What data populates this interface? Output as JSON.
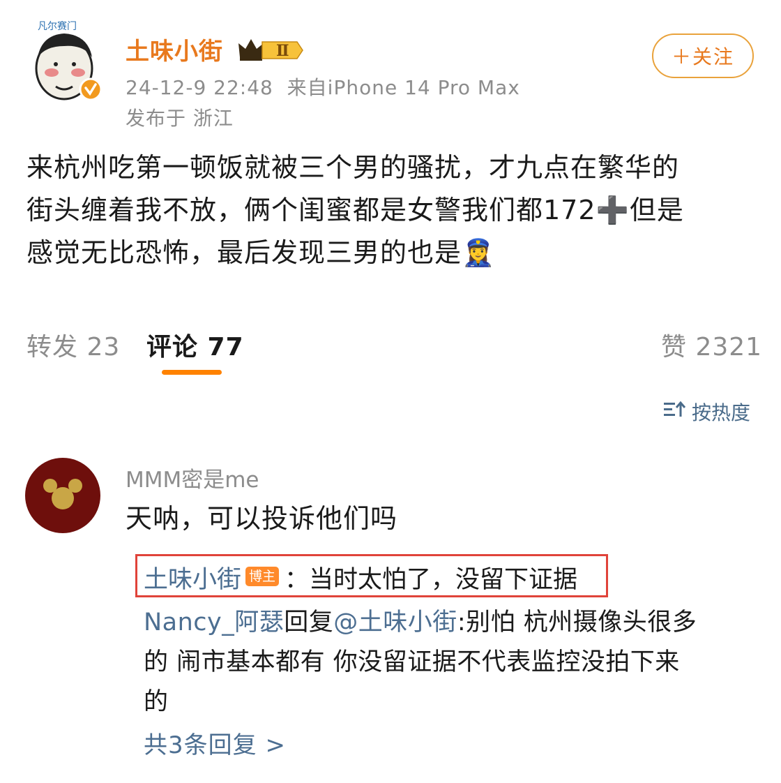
{
  "header": {
    "username": "土味小街",
    "vip_level": "Ⅱ",
    "meta": "24-12-9 22:48  来自iPhone 14 Pro Max",
    "location": "发布于 浙江",
    "follow_label": "＋关注",
    "avatar_watermark": "凡尔赛门"
  },
  "post": {
    "lines": [
      "来杭州吃第一顿饭就被三个男的骚扰，才九点在繁华的",
      "街头缠着我不放，俩个闺蜜都是女警我们都172➕但是",
      "感觉无比恐怖，最后发现三男的也是👮‍♀️"
    ]
  },
  "tabs": {
    "repost": "转发 23",
    "comment": "评论 77",
    "like": "赞 2321"
  },
  "sort_label": "按热度",
  "comment": {
    "author": "MMM密是me",
    "text": "天呐，可以投诉他们吗",
    "reply1": {
      "author": "土味小街",
      "tag": "博主",
      "text": "：当时太怕了，没留下证据"
    },
    "reply2": {
      "author": "Nancy_阿瑟",
      "reply_word": "回复",
      "mention": "@土味小街",
      "line1_rest": ":别怕 杭州摄像头很多",
      "line2": "的 闹市基本都有 你没留证据不代表监控没拍下来",
      "line3": "的"
    },
    "more_replies": "共3条回复 >"
  },
  "colors": {
    "accent_orange": "#ff8200",
    "link_blue": "#4c6e91",
    "highlight_red": "#e0433a"
  }
}
